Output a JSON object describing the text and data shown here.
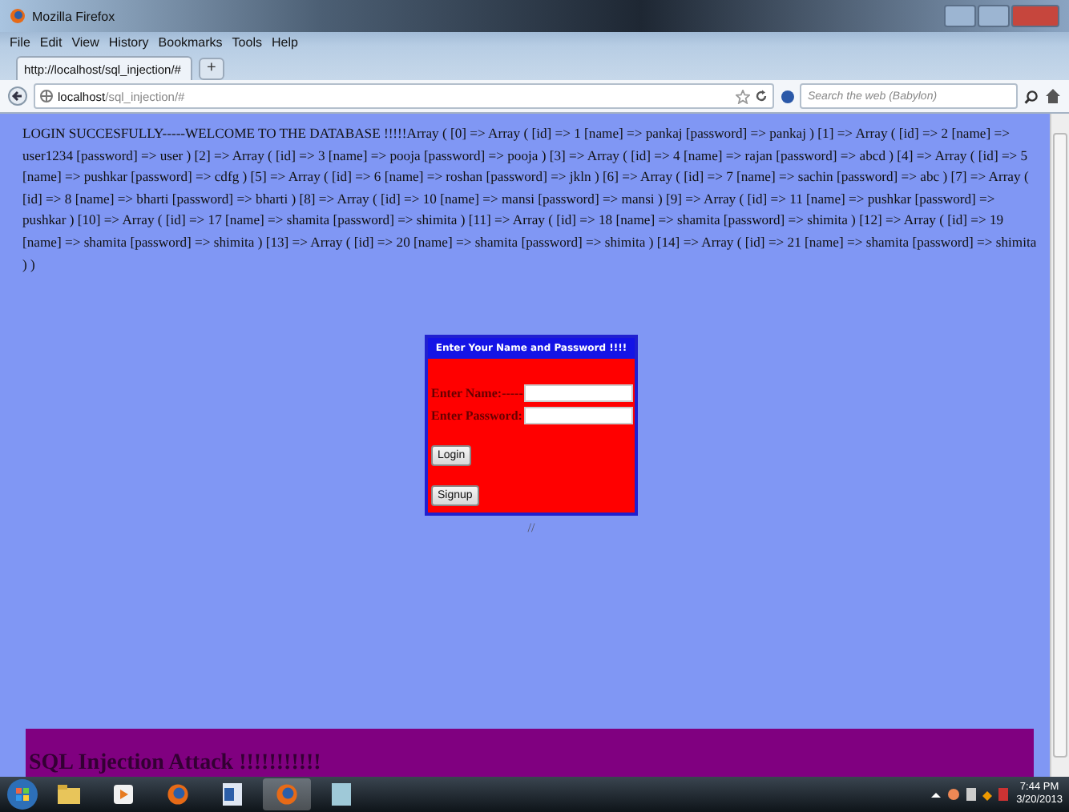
{
  "window": {
    "title": "Mozilla Firefox"
  },
  "menu": [
    "File",
    "Edit",
    "View",
    "History",
    "Bookmarks",
    "Tools",
    "Help"
  ],
  "tabs": [
    {
      "label": "http://localhost/sql_injection/#",
      "selected": true
    }
  ],
  "new_tab": "+",
  "address": {
    "host": "localhost",
    "path": "/sql_injection/#"
  },
  "search": {
    "placeholder": "Search the web (Babylon)"
  },
  "result_text": "LOGIN SUCCESFULLY-----WELCOME TO THE DATABASE !!!!!Array ( [0] => Array ( [id] => 1 [name] => pankaj [password] => pankaj ) [1] => Array ( [id] => 2 [name] => user1234 [password] => user ) [2] => Array ( [id] => 3 [name] => pooja [password] => pooja ) [3] => Array ( [id] => 4 [name] => rajan [password] => abcd ) [4] => Array ( [id] => 5 [name] => pushkar [password] => cdfg ) [5] => Array ( [id] => 6 [name] => roshan [password] => jkln ) [6] => Array ( [id] => 7 [name] => sachin [password] => abc ) [7] => Array ( [id] => 8 [name] => bharti [password] => bharti ) [8] => Array ( [id] => 10 [name] => mansi [password] => mansi ) [9] => Array ( [id] => 11 [name] => pushkar [password] => pushkar ) [10] => Array ( [id] => 17 [name] => shamita [password] => shimita ) [11] => Array ( [id] => 18 [name] => shamita [password] => shimita ) [12] => Array ( [id] => 19 [name] => shamita [password] => shimita ) [13] => Array ( [id] => 20 [name] => shamita [password] => shimita ) [14] => Array ( [id] => 21 [name] => shamita [password] => shimita ) )",
  "login_form": {
    "title": "Enter Your Name and Password !!!!",
    "fields": [
      {
        "label": "Enter Name:-----"
      },
      {
        "label": "Enter Password:"
      }
    ],
    "buttons": [
      "Login",
      "Signup"
    ]
  },
  "footer_mark": "//",
  "banner": "SQL Injection Attack !!!!!!!!!!!",
  "taskbar": {
    "time": "7:44 PM",
    "date": "3/20/2013"
  }
}
